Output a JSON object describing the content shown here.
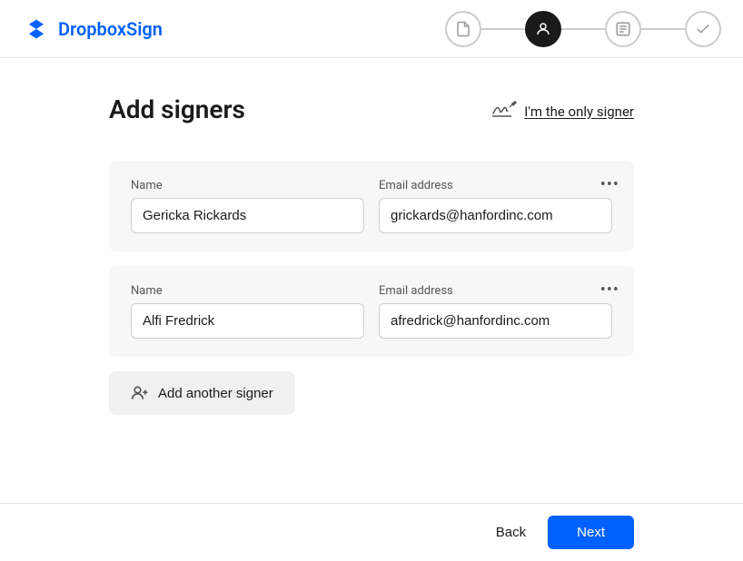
{
  "header": {
    "logo_text_main": "Dropbox",
    "logo_text_accent": "Sign"
  },
  "steps": [
    {
      "id": "document",
      "state": "complete"
    },
    {
      "id": "signers",
      "state": "active"
    },
    {
      "id": "fields",
      "state": "inactive"
    },
    {
      "id": "review",
      "state": "inactive"
    }
  ],
  "page": {
    "title": "Add signers",
    "only_signer_label": "I'm the only signer"
  },
  "signers": [
    {
      "name_label": "Name",
      "name_value": "Gericka Rickards",
      "email_label": "Email address",
      "email_value": "grickards@hanfordinc.com"
    },
    {
      "name_label": "Name",
      "name_value": "Alfi Fredrick",
      "email_label": "Email address",
      "email_value": "afredrick@hanfordinc.com"
    }
  ],
  "add_signer_label": "Add another signer",
  "footer": {
    "back_label": "Back",
    "next_label": "Next"
  }
}
